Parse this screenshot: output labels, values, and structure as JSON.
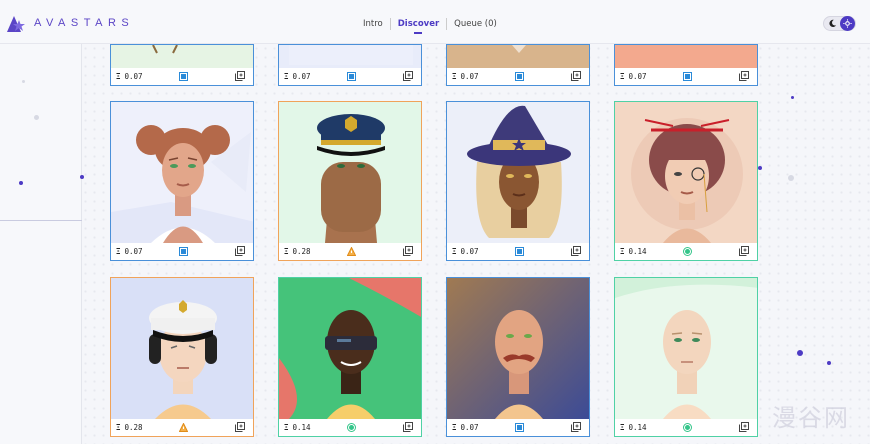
{
  "brand": {
    "name": "AVASTARS",
    "logo_icon": "avastars-star-logo-icon",
    "accent_color": "#4d3bc4"
  },
  "nav": {
    "tabs": [
      {
        "label": "Intro"
      },
      {
        "label": "Discover"
      },
      {
        "label": "Queue (0)"
      }
    ],
    "active_tab": "Discover"
  },
  "theme_toggle": {
    "left_icon": "moon-icon",
    "right_icon": "sun-icon",
    "mode": "light"
  },
  "grid": {
    "rows": [
      {
        "cards": [
          {
            "price": "0.07",
            "rarity": "common",
            "status_icon": "square-status-icon",
            "border": "#4a90d9"
          },
          {
            "price": "0.07",
            "rarity": "common",
            "status_icon": "square-status-icon",
            "border": "#4a90d9"
          },
          {
            "price": "0.07",
            "rarity": "common",
            "status_icon": "square-status-icon",
            "border": "#4a90d9"
          },
          {
            "price": "0.07",
            "rarity": "common",
            "status_icon": "square-status-icon",
            "border": "#4a90d9"
          }
        ]
      },
      {
        "cards": [
          {
            "price": "0.07",
            "rarity": "common",
            "status_icon": "square-status-icon",
            "border": "#4a90d9",
            "portrait": "curly-hair-pigtails-woman"
          },
          {
            "price": "0.28",
            "rarity": "rare",
            "status_icon": "triangle-status-icon",
            "border": "#f0a35a",
            "portrait": "police-cap-bearded"
          },
          {
            "price": "0.07",
            "rarity": "common",
            "status_icon": "square-status-icon",
            "border": "#4a90d9",
            "portrait": "witch-hat-woman"
          },
          {
            "price": "0.14",
            "rarity": "uncommon",
            "status_icon": "circle-status-icon",
            "border": "#4fd1a5",
            "portrait": "geisha-hair-monocle"
          }
        ]
      },
      {
        "cards": [
          {
            "price": "0.28",
            "rarity": "rare",
            "status_icon": "triangle-status-icon",
            "border": "#f0a35a",
            "portrait": "captain-cap-headphones"
          },
          {
            "price": "0.14",
            "rarity": "uncommon",
            "status_icon": "circle-status-icon",
            "border": "#4fd1a5",
            "portrait": "vr-visor-bald"
          },
          {
            "price": "0.07",
            "rarity": "common",
            "status_icon": "square-status-icon",
            "border": "#4a90d9",
            "portrait": "bald-mustache-man"
          },
          {
            "price": "0.14",
            "rarity": "uncommon",
            "status_icon": "circle-status-icon",
            "border": "#4fd1a5",
            "portrait": "bald-pale-man"
          }
        ]
      }
    ],
    "currency_glyph": "Ξ",
    "action_icon": "add-to-queue-icon"
  },
  "watermark": "漫谷网"
}
